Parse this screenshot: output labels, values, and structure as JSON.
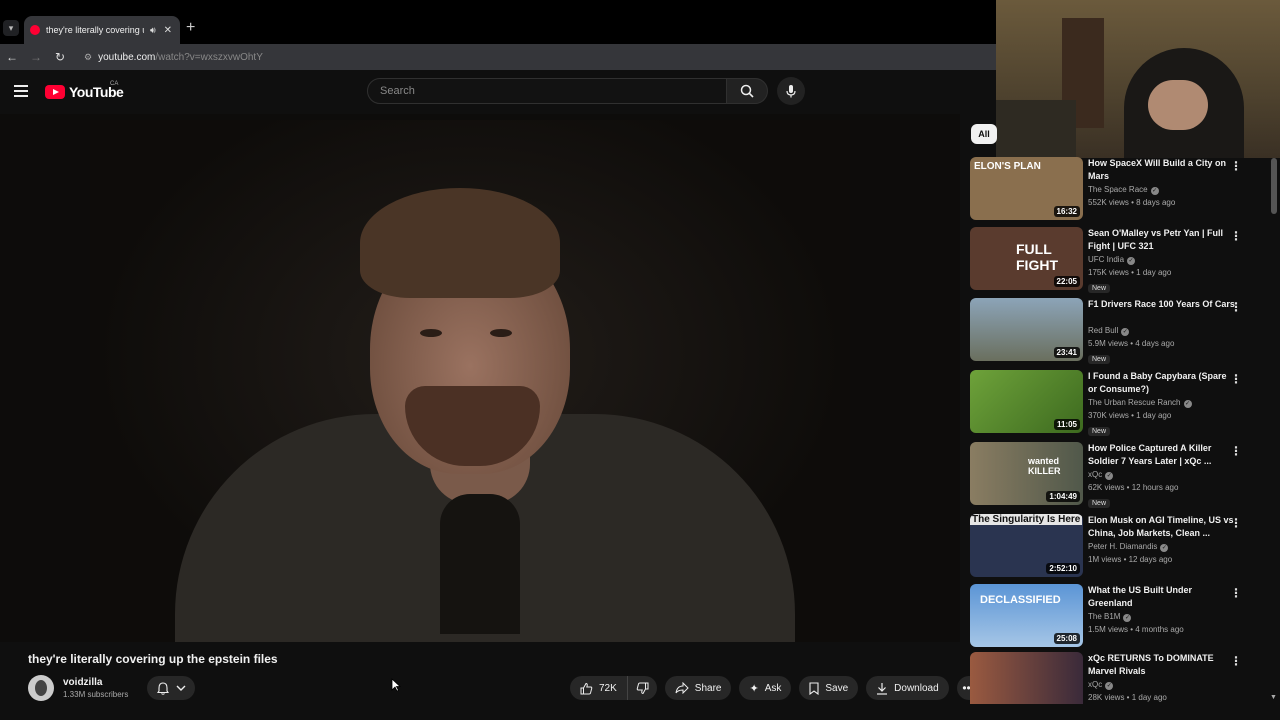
{
  "browser": {
    "tab_title": "they're literally covering up",
    "url_host": "youtube.com",
    "url_path": "/watch?v=wxszxvwOhtY"
  },
  "header": {
    "logo_text": "YouTube",
    "region": "CA",
    "search_placeholder": "Search"
  },
  "video": {
    "title": "they're literally covering up the epstein files",
    "channel": "voidzilla",
    "subscribers": "1.33M subscribers",
    "likes": "72K",
    "share_label": "Share",
    "ask_label": "Ask",
    "save_label": "Save",
    "download_label": "Download"
  },
  "chips": {
    "all": "All"
  },
  "recommendations": [
    {
      "title": "How SpaceX Will Build a City on Mars",
      "channel": "The Space Race",
      "meta": "552K views • 8 days ago",
      "duration": "16:32",
      "badge": "",
      "thumb_text": "ELON'S PLAN",
      "thumb_color": "#8a6f4e"
    },
    {
      "title": "Sean O'Malley vs Petr Yan | Full Fight | UFC 321",
      "channel": "UFC India",
      "meta": "175K views • 1 day ago",
      "duration": "22:05",
      "badge": "New",
      "thumb_text": "FULL FIGHT",
      "thumb_color": "#5a3b2e"
    },
    {
      "title": "F1 Drivers Race 100 Years Of Cars",
      "channel": "Red Bull",
      "meta": "5.9M views • 4 days ago",
      "duration": "23:41",
      "badge": "New",
      "thumb_text": "",
      "thumb_color": "#6d7f90"
    },
    {
      "title": "I Found a Baby Capybara (Spare or Consume?)",
      "channel": "The Urban Rescue Ranch",
      "meta": "370K views • 1 day ago",
      "duration": "11:05",
      "badge": "New",
      "thumb_text": "",
      "thumb_color": "#4f7a2a"
    },
    {
      "title": "How Police Captured A Killer Soldier 7 Years Later | xQc ...",
      "channel": "xQc",
      "meta": "62K views • 12 hours ago",
      "duration": "1:04:49",
      "badge": "New",
      "thumb_text": "wanted KILLER",
      "thumb_color": "#6a6a5a"
    },
    {
      "title": "Elon Musk on AGI Timeline, US vs China, Job Markets, Clean ...",
      "channel": "Peter H. Diamandis",
      "meta": "1M views • 12 days ago",
      "duration": "2:52:10",
      "badge": "",
      "thumb_text": "The Singularity Is Here",
      "thumb_color": "#2a3450"
    },
    {
      "title": "What the US Built Under Greenland",
      "channel": "The B1M",
      "meta": "1.5M views • 4 months ago",
      "duration": "25:08",
      "badge": "",
      "thumb_text": "DECLASSIFIED",
      "thumb_color": "#4f86c6"
    },
    {
      "title": "xQc RETURNS To DOMINATE Marvel Rivals",
      "channel": "xQc",
      "meta": "28K views • 1 day ago",
      "duration": "",
      "badge": "",
      "thumb_text": "",
      "thumb_color": "#7a4a3a"
    }
  ]
}
